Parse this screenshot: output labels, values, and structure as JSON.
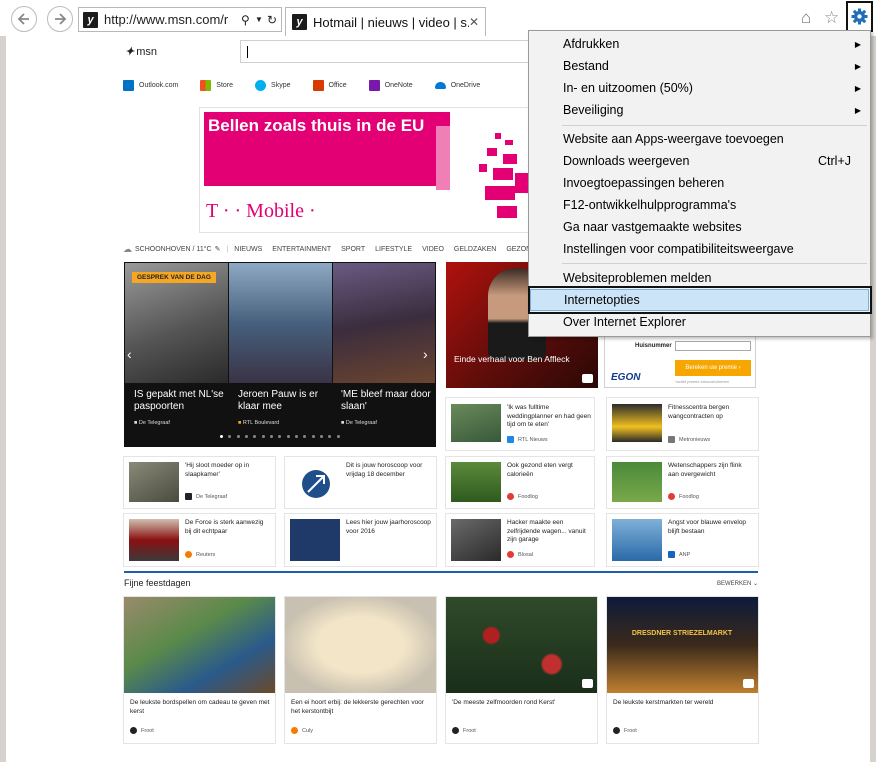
{
  "browser": {
    "url": "http://www.msn.com/r",
    "tab_title": "Hotmail | nieuws | video | s..."
  },
  "msn": {
    "logo": "msn",
    "apps": [
      "Outlook.com",
      "Store",
      "Skype",
      "Office",
      "OneNote",
      "OneDrive"
    ],
    "app_colors": [
      "#0072c6",
      "#f25022",
      "#00aff0",
      "#d83b01",
      "#7719aa",
      "#0078d7"
    ],
    "ad": {
      "headline": "Bellen zoals thuis in de EU",
      "brand": "T · · Mobile ·"
    },
    "weather": "SCHOONHOVEN / 11°C",
    "nav": [
      "NIEUWS",
      "ENTERTAINMENT",
      "SPORT",
      "LIFESTYLE",
      "VIDEO",
      "GELDZAKEN",
      "GEZONDHEID"
    ],
    "hero": {
      "badge": "GESPREK VAN DE DAG",
      "slides": [
        {
          "title": "IS gepakt met NL'se paspoorten",
          "source": "De Telegraaf"
        },
        {
          "title": "Jeroen Pauw is er klaar mee",
          "source": "RTL Boulevard"
        },
        {
          "title": "'ME bleef maar door slaan'",
          "source": "De Telegraaf"
        }
      ]
    },
    "feature": {
      "title": "Eindeverhaal voor Ben Affleck"
    },
    "egon": {
      "field": "Huisnummer",
      "button": "Bereken uw premie",
      "brand": "EGON",
      "note": "*actief premie inbouwhdromen"
    },
    "news": [
      {
        "text": "'Ik was fulltime weddingplanner en had geen tijd om te eten'",
        "source": "RTL Nieuws"
      },
      {
        "text": "Fitnesscentra bergen wangcontracten op",
        "source": "Metronieuws"
      },
      {
        "text": "'Hij sloot moeder op in slaapkamer'",
        "source": "De Telegraaf"
      },
      {
        "text": "Dit is jouw horoscoop voor vrijdag 18 december",
        "source": ""
      },
      {
        "text": "Ook gezond eten vergt calorieën",
        "source": "Foodlog"
      },
      {
        "text": "Wetenschappers zijn flink aan overgewicht",
        "source": "Foodlog"
      },
      {
        "text": "De Force is sterk aanwezig bij dit echtpaar",
        "source": "Reuters"
      },
      {
        "text": "Lees hier jouw jaarhoroscoop voor 2016",
        "source": ""
      },
      {
        "text": "Hacker maakte een zelfrijdende wagen... vanuit zijn garage",
        "source": "Blosal"
      },
      {
        "text": "Angst voor blauwe envelop blijft bestaan",
        "source": "ANP"
      }
    ],
    "section": {
      "title": "Fijne feestdagen",
      "edit": "BEWERKEN"
    },
    "holiday": [
      {
        "text": "De leukste bordspellen om cadeau te geven met kerst",
        "source": "Froot"
      },
      {
        "text": "Een ei hoort erbij: de lekkerste gerechten voor het kerstontbijt",
        "source": "Culy"
      },
      {
        "text": "'De meeste zelfmoorden rond Kerst'",
        "source": "Froot"
      },
      {
        "text": "De leukste kerstmarkten ter wereld",
        "source": "Froot"
      }
    ],
    "market_sign": "DRESDNER STRIEZELMARKT"
  },
  "menu": {
    "items": [
      {
        "label": "Afdrukken",
        "shortcut": "",
        "sub": true
      },
      {
        "label": "Bestand",
        "shortcut": "",
        "sub": true
      },
      {
        "label": "In- en uitzoomen (50%)",
        "shortcut": "",
        "sub": true
      },
      {
        "label": "Beveiliging",
        "shortcut": "",
        "sub": true
      },
      {
        "label": "Website aan Apps-weergave toevoegen",
        "shortcut": "",
        "sub": false
      },
      {
        "label": "Downloads weergeven",
        "shortcut": "Ctrl+J",
        "sub": false
      },
      {
        "label": "Invoegtoepassingen beheren",
        "shortcut": "",
        "sub": false
      },
      {
        "label": "F12-ontwikkelhulpprogramma's",
        "shortcut": "",
        "sub": false
      },
      {
        "label": "Ga naar vastgemaakte websites",
        "shortcut": "",
        "sub": false
      },
      {
        "label": "Instellingen voor compatibiliteitsweergave",
        "shortcut": "",
        "sub": false
      },
      {
        "label": "Websiteproblemen melden",
        "shortcut": "",
        "sub": false
      },
      {
        "label": "Internetopties",
        "shortcut": "",
        "sub": false
      },
      {
        "label": "Over Internet Explorer",
        "shortcut": "",
        "sub": false
      }
    ]
  }
}
